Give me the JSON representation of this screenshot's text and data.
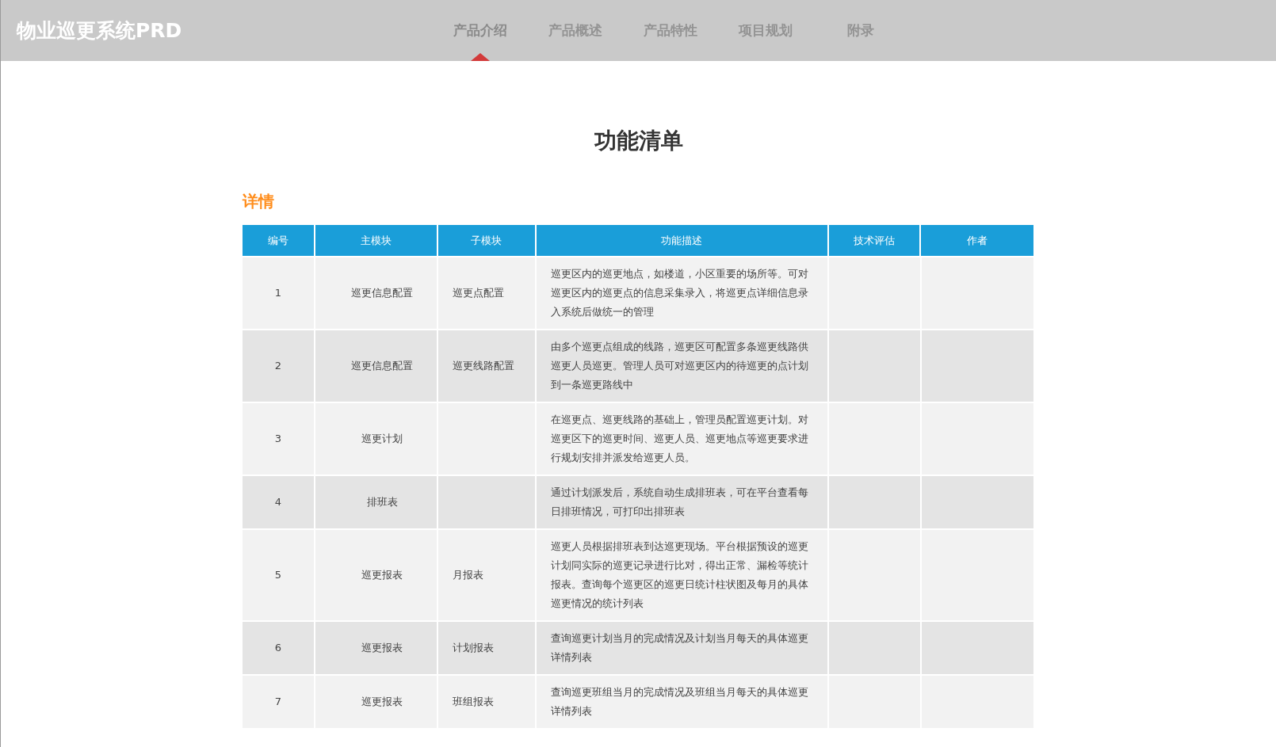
{
  "header": {
    "logo": "物业巡更系统PRD",
    "nav": [
      {
        "label": "产品介绍",
        "selected": true
      },
      {
        "label": "产品概述",
        "selected": false
      },
      {
        "label": "产品特性",
        "selected": false
      },
      {
        "label": "项目规划",
        "selected": false
      },
      {
        "label": "附录",
        "selected": false
      }
    ]
  },
  "page_title": "功能清单",
  "section_title": "详情",
  "table": {
    "columns": [
      "编号",
      "主模块",
      "子模块",
      "功能描述",
      "技术评估",
      "作者"
    ],
    "rows": [
      {
        "number": "1",
        "main_module": "巡更信息配置",
        "sub_module": "巡更点配置",
        "description": "巡更区内的巡更地点，如楼道，小区重要的场所等。可对巡更区内的巡更点的信息采集录入，将巡更点详细信息录入系统后做统一的管理"
      },
      {
        "number": "2",
        "main_module": "巡更信息配置",
        "sub_module": "巡更线路配置",
        "description": "由多个巡更点组成的线路，巡更区可配置多条巡更线路供巡更人员巡更。管理人员可对巡更区内的待巡更的点计划到一条巡更路线中"
      },
      {
        "number": "3",
        "main_module": "巡更计划",
        "description": "在巡更点、巡更线路的基础上，管理员配置巡更计划。对巡更区下的巡更时间、巡更人员、巡更地点等巡更要求进行规划安排并派发给巡更人员。"
      },
      {
        "number": "4",
        "main_module": "排班表",
        "description": "通过计划派发后，系统自动生成排班表，可在平台查看每日排班情况，可打印出排班表"
      },
      {
        "number": "5",
        "main_module": "巡更报表",
        "sub_module": "月报表",
        "description": "巡更人员根据排班表到达巡更现场。平台根据预设的巡更计划同实际的巡更记录进行比对，得出正常、漏检等统计报表。查询每个巡更区的巡更日统计柱状图及每月的具体巡更情况的统计列表"
      },
      {
        "number": "6",
        "main_module": "巡更报表",
        "sub_module": "计划报表",
        "description": "查询巡更计划当月的完成情况及计划当月每天的具体巡更详情列表"
      },
      {
        "number": "7",
        "main_module": "巡更报表",
        "sub_module": "班组报表",
        "description": "查询巡更班组当月的完成情况及班组当月每天的具体巡更详情列表"
      }
    ]
  }
}
